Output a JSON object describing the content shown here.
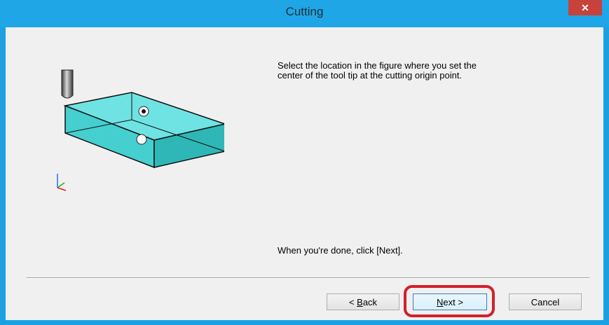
{
  "window": {
    "title": "Cutting",
    "close_label": "✕"
  },
  "content": {
    "instruction": "Select the location in the figure where you set the\ncenter of the tool tip at the cutting origin point.",
    "done_text": "When you're done, click [Next]."
  },
  "buttons": {
    "back_prefix": "< ",
    "back_mnemonic": "B",
    "back_rest": "ack",
    "next_mnemonic": "N",
    "next_rest": "ext >",
    "cancel": "Cancel"
  },
  "colors": {
    "titlebar": "#1fa6e6",
    "close_button": "#c7423a",
    "box_fill": "#4fd6d6",
    "highlight": "#d21f2b"
  }
}
